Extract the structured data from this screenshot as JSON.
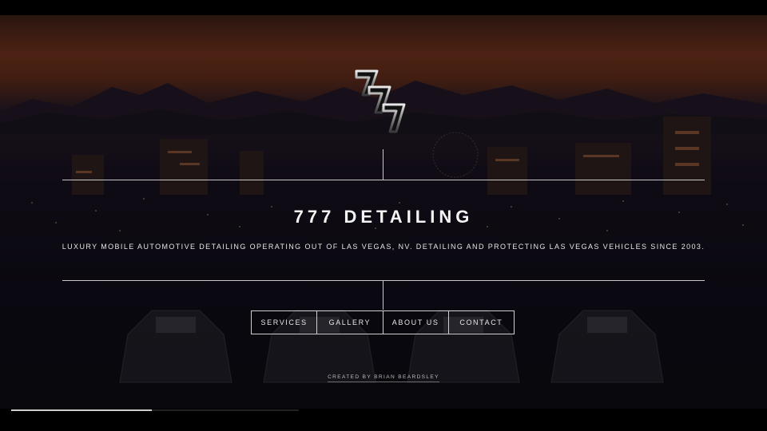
{
  "site": {
    "title": "777 DETAILING",
    "tagline": "LUXURY MOBILE AUTOMOTIVE DETAILING OPERATING OUT OF LAS VEGAS, NV. DETAILING AND PROTECTING LAS VEGAS VEHICLES SINCE 2003.",
    "logo_text": "777",
    "logo_icon": "triple-seven-logo"
  },
  "nav": {
    "items": [
      {
        "label": "SERVICES"
      },
      {
        "label": "GALLERY"
      },
      {
        "label": "ABOUT US"
      },
      {
        "label": "CONTACT"
      }
    ]
  },
  "footer": {
    "credit": "CREATED BY BRIAN BEARDSLEY"
  },
  "video": {
    "progress": 0.49
  },
  "colors": {
    "sky_glow": "#6a2f18",
    "text": "#f4f4f4",
    "lines": "#c8c8c8"
  }
}
